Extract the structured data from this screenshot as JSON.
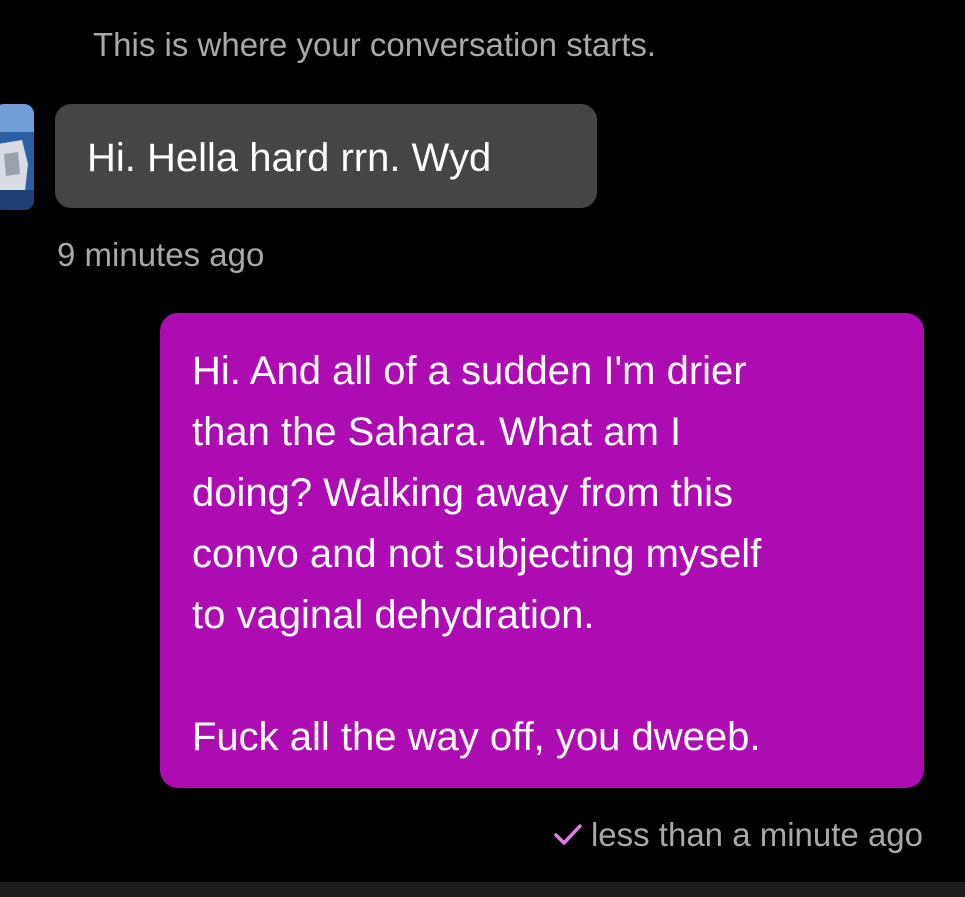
{
  "conversation": {
    "start_label": "This is where your conversation starts."
  },
  "incoming_message": {
    "text": "Hi. Hella hard rrn. Wyd",
    "timestamp": "9 minutes ago"
  },
  "outgoing_message": {
    "lines": [
      "Hi. And all of a sudden I'm drier",
      "than the Sahara. What am I",
      "doing? Walking away from this",
      "convo and not subjecting myself",
      "to vaginal dehydration.",
      "Fuck all the way off, you dweeb."
    ],
    "timestamp": "less than a minute ago",
    "status_icon": "checkmark-icon"
  },
  "colors": {
    "background": "#000000",
    "incoming_bubble": "#454545",
    "outgoing_bubble": "#ad0cb3",
    "secondary_text": "#a8a8a8",
    "check": "#e07ae6"
  }
}
